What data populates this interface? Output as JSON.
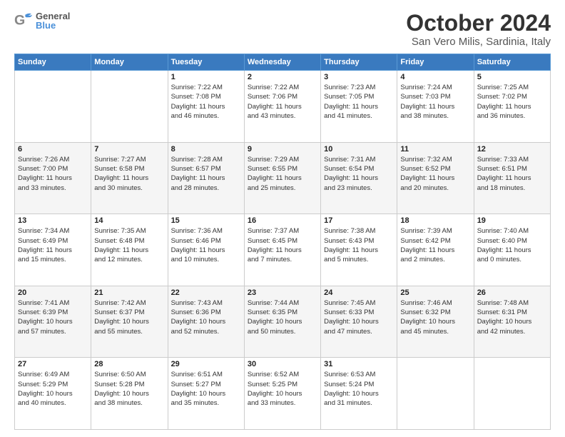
{
  "header": {
    "logo_general": "General",
    "logo_blue": "Blue",
    "title": "October 2024",
    "subtitle": "San Vero Milis, Sardinia, Italy"
  },
  "weekdays": [
    "Sunday",
    "Monday",
    "Tuesday",
    "Wednesday",
    "Thursday",
    "Friday",
    "Saturday"
  ],
  "weeks": [
    [
      {
        "day": "",
        "info": ""
      },
      {
        "day": "",
        "info": ""
      },
      {
        "day": "1",
        "info": "Sunrise: 7:22 AM\nSunset: 7:08 PM\nDaylight: 11 hours\nand 46 minutes."
      },
      {
        "day": "2",
        "info": "Sunrise: 7:22 AM\nSunset: 7:06 PM\nDaylight: 11 hours\nand 43 minutes."
      },
      {
        "day": "3",
        "info": "Sunrise: 7:23 AM\nSunset: 7:05 PM\nDaylight: 11 hours\nand 41 minutes."
      },
      {
        "day": "4",
        "info": "Sunrise: 7:24 AM\nSunset: 7:03 PM\nDaylight: 11 hours\nand 38 minutes."
      },
      {
        "day": "5",
        "info": "Sunrise: 7:25 AM\nSunset: 7:02 PM\nDaylight: 11 hours\nand 36 minutes."
      }
    ],
    [
      {
        "day": "6",
        "info": "Sunrise: 7:26 AM\nSunset: 7:00 PM\nDaylight: 11 hours\nand 33 minutes."
      },
      {
        "day": "7",
        "info": "Sunrise: 7:27 AM\nSunset: 6:58 PM\nDaylight: 11 hours\nand 30 minutes."
      },
      {
        "day": "8",
        "info": "Sunrise: 7:28 AM\nSunset: 6:57 PM\nDaylight: 11 hours\nand 28 minutes."
      },
      {
        "day": "9",
        "info": "Sunrise: 7:29 AM\nSunset: 6:55 PM\nDaylight: 11 hours\nand 25 minutes."
      },
      {
        "day": "10",
        "info": "Sunrise: 7:31 AM\nSunset: 6:54 PM\nDaylight: 11 hours\nand 23 minutes."
      },
      {
        "day": "11",
        "info": "Sunrise: 7:32 AM\nSunset: 6:52 PM\nDaylight: 11 hours\nand 20 minutes."
      },
      {
        "day": "12",
        "info": "Sunrise: 7:33 AM\nSunset: 6:51 PM\nDaylight: 11 hours\nand 18 minutes."
      }
    ],
    [
      {
        "day": "13",
        "info": "Sunrise: 7:34 AM\nSunset: 6:49 PM\nDaylight: 11 hours\nand 15 minutes."
      },
      {
        "day": "14",
        "info": "Sunrise: 7:35 AM\nSunset: 6:48 PM\nDaylight: 11 hours\nand 12 minutes."
      },
      {
        "day": "15",
        "info": "Sunrise: 7:36 AM\nSunset: 6:46 PM\nDaylight: 11 hours\nand 10 minutes."
      },
      {
        "day": "16",
        "info": "Sunrise: 7:37 AM\nSunset: 6:45 PM\nDaylight: 11 hours\nand 7 minutes."
      },
      {
        "day": "17",
        "info": "Sunrise: 7:38 AM\nSunset: 6:43 PM\nDaylight: 11 hours\nand 5 minutes."
      },
      {
        "day": "18",
        "info": "Sunrise: 7:39 AM\nSunset: 6:42 PM\nDaylight: 11 hours\nand 2 minutes."
      },
      {
        "day": "19",
        "info": "Sunrise: 7:40 AM\nSunset: 6:40 PM\nDaylight: 11 hours\nand 0 minutes."
      }
    ],
    [
      {
        "day": "20",
        "info": "Sunrise: 7:41 AM\nSunset: 6:39 PM\nDaylight: 10 hours\nand 57 minutes."
      },
      {
        "day": "21",
        "info": "Sunrise: 7:42 AM\nSunset: 6:37 PM\nDaylight: 10 hours\nand 55 minutes."
      },
      {
        "day": "22",
        "info": "Sunrise: 7:43 AM\nSunset: 6:36 PM\nDaylight: 10 hours\nand 52 minutes."
      },
      {
        "day": "23",
        "info": "Sunrise: 7:44 AM\nSunset: 6:35 PM\nDaylight: 10 hours\nand 50 minutes."
      },
      {
        "day": "24",
        "info": "Sunrise: 7:45 AM\nSunset: 6:33 PM\nDaylight: 10 hours\nand 47 minutes."
      },
      {
        "day": "25",
        "info": "Sunrise: 7:46 AM\nSunset: 6:32 PM\nDaylight: 10 hours\nand 45 minutes."
      },
      {
        "day": "26",
        "info": "Sunrise: 7:48 AM\nSunset: 6:31 PM\nDaylight: 10 hours\nand 42 minutes."
      }
    ],
    [
      {
        "day": "27",
        "info": "Sunrise: 6:49 AM\nSunset: 5:29 PM\nDaylight: 10 hours\nand 40 minutes."
      },
      {
        "day": "28",
        "info": "Sunrise: 6:50 AM\nSunset: 5:28 PM\nDaylight: 10 hours\nand 38 minutes."
      },
      {
        "day": "29",
        "info": "Sunrise: 6:51 AM\nSunset: 5:27 PM\nDaylight: 10 hours\nand 35 minutes."
      },
      {
        "day": "30",
        "info": "Sunrise: 6:52 AM\nSunset: 5:25 PM\nDaylight: 10 hours\nand 33 minutes."
      },
      {
        "day": "31",
        "info": "Sunrise: 6:53 AM\nSunset: 5:24 PM\nDaylight: 10 hours\nand 31 minutes."
      },
      {
        "day": "",
        "info": ""
      },
      {
        "day": "",
        "info": ""
      }
    ]
  ]
}
